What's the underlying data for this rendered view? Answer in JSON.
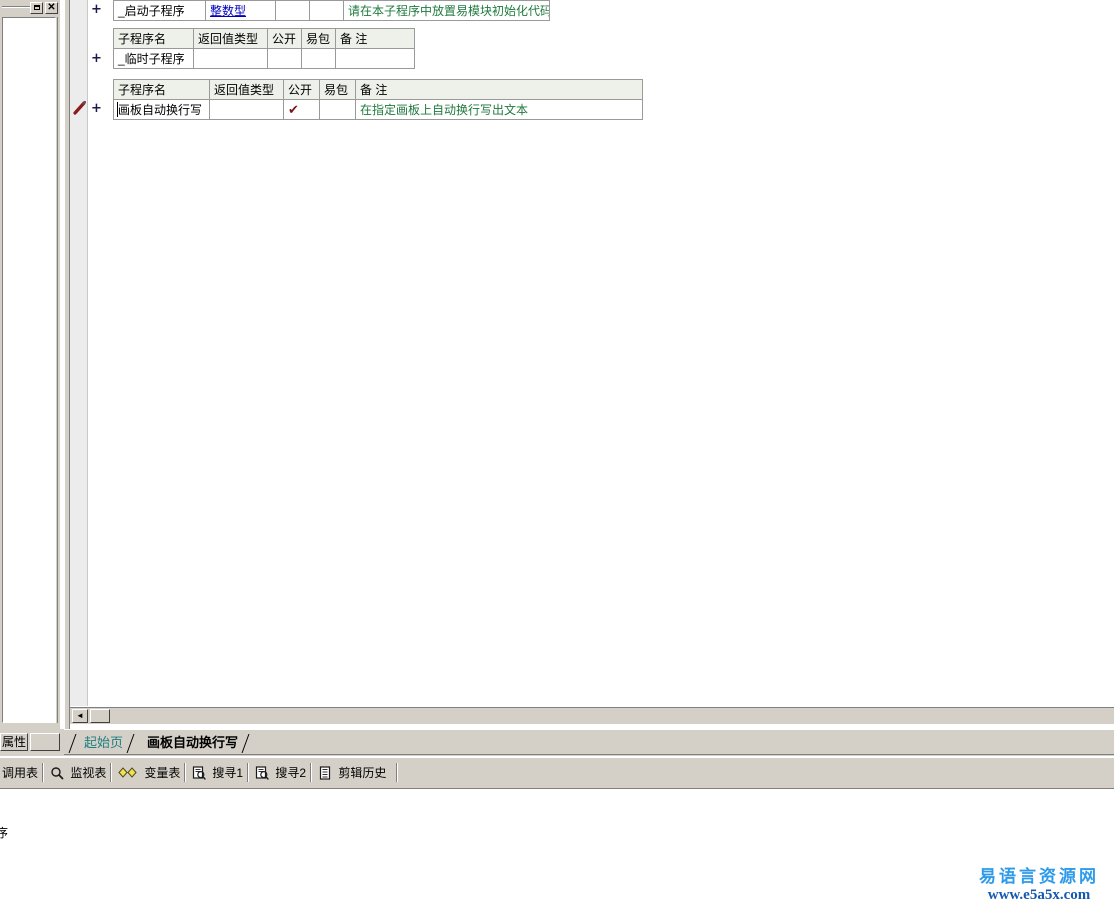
{
  "window": {
    "maximize_label": "□",
    "close_label": "✕"
  },
  "left_panel": {
    "properties_tab_label": "属性"
  },
  "editor": {
    "tables": [
      {
        "id": "startup-subroutine",
        "show_header": false,
        "headers": [
          "子程序名",
          "返回值类型",
          "公开",
          "易包",
          "备 注"
        ],
        "rows": [
          {
            "name": "_启动子程序",
            "return_type": "整数型",
            "public": "",
            "easy_pack": "",
            "remark": "请在本子程序中放置易模块初始化代码"
          }
        ]
      },
      {
        "id": "temp-subroutine",
        "show_header": true,
        "headers": [
          "子程序名",
          "返回值类型",
          "公开",
          "易包",
          "备 注"
        ],
        "rows": [
          {
            "name": "_临时子程序",
            "return_type": "",
            "public": "",
            "easy_pack": "",
            "remark": ""
          }
        ]
      },
      {
        "id": "canvas-wrap-write",
        "show_header": true,
        "headers": [
          "子程序名",
          "返回值类型",
          "公开",
          "易包",
          "备 注"
        ],
        "rows": [
          {
            "name": "画板自动换行写",
            "return_type": "",
            "public": "✔",
            "easy_pack": "",
            "remark": "在指定画板上自动换行写出文本"
          }
        ]
      }
    ],
    "expand_marker": "+",
    "scrollbar": {
      "left_arrow": "◄"
    }
  },
  "doc_tabs": [
    {
      "label": "起始页",
      "active": false
    },
    {
      "label": "画板自动换行写",
      "active": true
    }
  ],
  "bottom_tabs": [
    {
      "label": "调用表",
      "icon": ""
    },
    {
      "label": "监视表",
      "icon": "magnifier-icon"
    },
    {
      "label": "变量表",
      "icon": "diamonds-icon"
    },
    {
      "label": "搜寻1",
      "icon": "search-document-icon"
    },
    {
      "label": "搜寻2",
      "icon": "search-document-icon"
    },
    {
      "label": "剪辑历史",
      "icon": "clipboard-list-icon"
    }
  ],
  "output": {
    "text": "序"
  },
  "watermark": {
    "site_name": "易语言资源网",
    "url": "www.e5a5x.com"
  },
  "colors": {
    "chrome": "#d4d0c8",
    "table_header": "#eef1e9",
    "type_blue": "#0000bb",
    "remark_green": "#1f7a3d",
    "check_maroon": "#7a1414",
    "tab_teal": "#1f7f7f",
    "watermark_blue": "#2e9bea",
    "watermark_url_blue": "#1558b0"
  }
}
